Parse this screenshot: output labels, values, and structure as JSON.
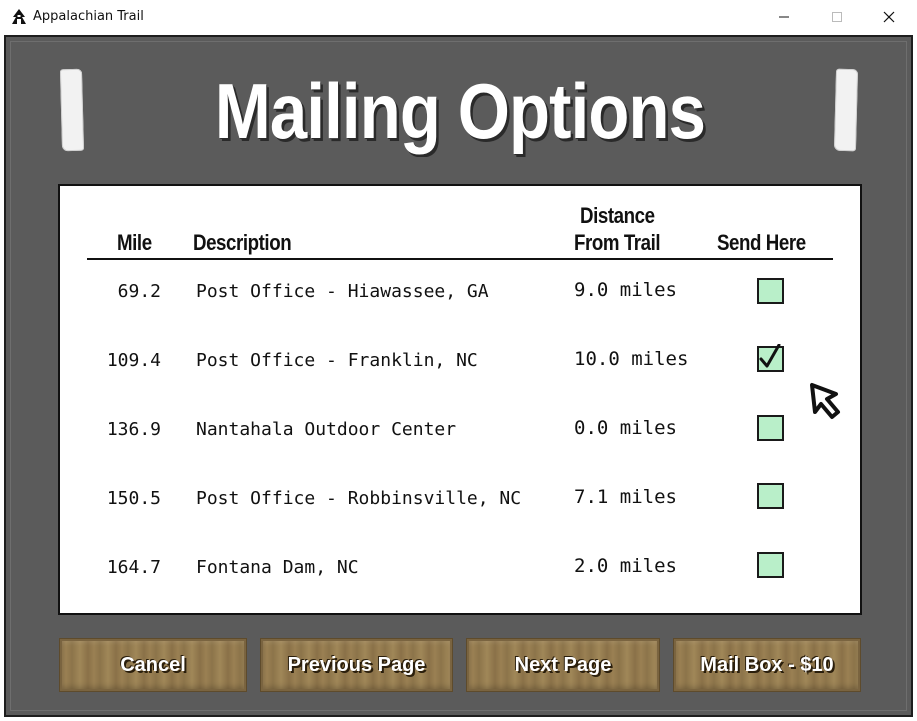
{
  "window": {
    "title": "Appalachian Trail",
    "icon": "appalachian-trail-logo-icon",
    "controls": [
      "minimize-icon",
      "maximize-icon",
      "close-icon"
    ]
  },
  "screen": {
    "title": "Mailing Options"
  },
  "table": {
    "headers": {
      "mile": "Mile",
      "description": "Description",
      "distance_line1": "Distance",
      "distance_line2": "From Trail",
      "send": "Send Here"
    },
    "rows": [
      {
        "mile": "69.2",
        "description": "Post Office - Hiawassee, GA",
        "distance": "9.0 miles",
        "checked": false
      },
      {
        "mile": "109.4",
        "description": "Post Office - Franklin, NC",
        "distance": "10.0 miles",
        "checked": true
      },
      {
        "mile": "136.9",
        "description": "Nantahala Outdoor Center",
        "distance": "0.0 miles",
        "checked": false
      },
      {
        "mile": "150.5",
        "description": "Post Office - Robbinsville, NC",
        "distance": "7.1 miles",
        "checked": false
      },
      {
        "mile": "164.7",
        "description": "Fontana Dam, NC",
        "distance": "2.0 miles",
        "checked": false
      }
    ]
  },
  "buttons": {
    "cancel": "Cancel",
    "previous": "Previous Page",
    "next": "Next Page",
    "mail_box": "Mail Box - $10"
  },
  "colors": {
    "frame": "#5b5b5b",
    "checkbox_fill": "#b9efc9",
    "button_wood": "#8a7148"
  }
}
